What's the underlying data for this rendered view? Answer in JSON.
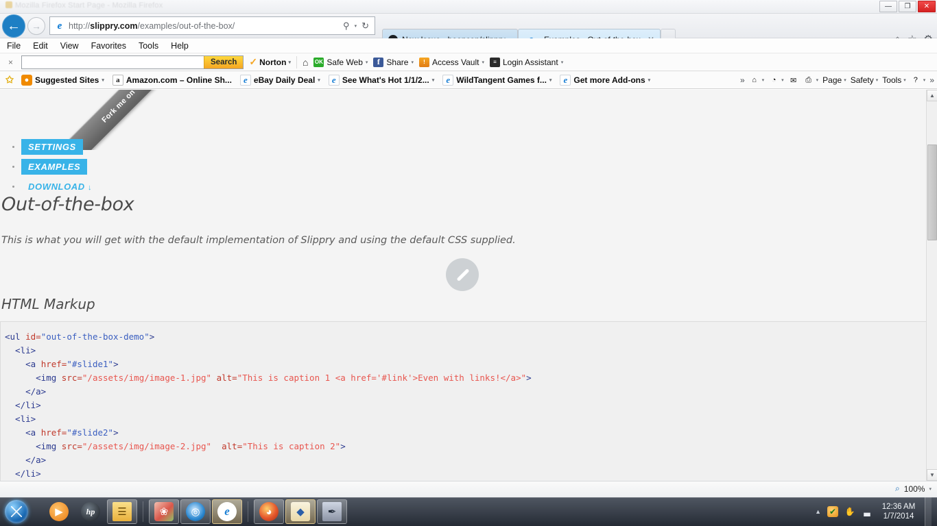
{
  "window": {
    "ghost_title": "Mozilla Firefox Start Page - Mozilla Firefox",
    "minimize": "—",
    "maximize": "❐",
    "close": "✕"
  },
  "browser": {
    "back_icon": "←",
    "forward_icon": "→",
    "url_prefix": "http://",
    "url_domain": "slippry.com",
    "url_path": "/examples/out-of-the-box/",
    "search_in_address_icon": "⚲",
    "address_caret": "▾",
    "refresh_icon": "↻",
    "tabs": [
      {
        "title": "New Issue · booncon/slippry",
        "icon": "github-icon",
        "active": false
      },
      {
        "title": "Examples - Out-of-the-box",
        "icon": "ie-icon",
        "active": true,
        "close": "✕"
      }
    ],
    "new_tab_label": "",
    "right_icons": [
      {
        "name": "home-icon",
        "glyph": "⌂"
      },
      {
        "name": "favorites-star-icon",
        "glyph": "☆"
      },
      {
        "name": "tools-gear-icon",
        "glyph": "⚙"
      }
    ]
  },
  "menubar": {
    "items": [
      "File",
      "Edit",
      "View",
      "Favorites",
      "Tools",
      "Help"
    ]
  },
  "toolbar_search": {
    "close_label": "×",
    "input_value": "",
    "input_placeholder": "",
    "search_button": "Search",
    "norton_label": "Norton",
    "norton_caret": "▾",
    "home_glyph": "⌂",
    "items": [
      {
        "label": "Safe Web",
        "badge": "OK",
        "badge_class": "badge-ok",
        "caret": "▾"
      },
      {
        "label": "Share",
        "badge": "f",
        "badge_class": "badge-fb",
        "caret": "▾"
      },
      {
        "label": "Access Vault",
        "badge": "!",
        "badge_class": "badge-vault",
        "caret": "▾"
      },
      {
        "label": "Login Assistant",
        "badge": "≡",
        "badge_class": "badge-login",
        "caret": "▾"
      }
    ]
  },
  "favorites_bar": {
    "add_star": "✩",
    "items": [
      {
        "label": "Suggested Sites",
        "icon": "suggested-sites-icon",
        "icon_class": "ico-sugg",
        "glyph": "●",
        "caret": "▾"
      },
      {
        "label": "Amazon.com – Online Sh...",
        "icon": "amazon-icon",
        "icon_class": "ico-amz",
        "glyph": "a",
        "caret": ""
      },
      {
        "label": "eBay Daily Deal",
        "icon": "ie-page-icon",
        "icon_class": "ico-ie",
        "glyph": "e",
        "caret": "▾"
      },
      {
        "label": "See What's Hot 1/1/2...",
        "icon": "ie-page-icon",
        "icon_class": "ico-ie",
        "glyph": "e",
        "caret": "▾"
      },
      {
        "label": "WildTangent Games f...",
        "icon": "ie-page-icon",
        "icon_class": "ico-ie",
        "glyph": "e",
        "caret": "▾"
      },
      {
        "label": "Get more Add-ons",
        "icon": "ie-page-icon",
        "icon_class": "ico-ie",
        "glyph": "e",
        "caret": "▾"
      }
    ],
    "overflow_chevron": "»",
    "command_items": [
      {
        "label": "",
        "name": "home-icon",
        "glyph": "⌂",
        "caret": "▾"
      },
      {
        "label": "",
        "name": "feeds-icon",
        "glyph": "◔",
        "caret": "▾"
      },
      {
        "label": "",
        "name": "read-mail-icon",
        "glyph": "✉",
        "caret": ""
      },
      {
        "label": "",
        "name": "print-icon",
        "glyph": "⎙",
        "caret": "▾"
      },
      {
        "label": "Page",
        "name": "page-menu",
        "glyph": "",
        "caret": "▾"
      },
      {
        "label": "Safety",
        "name": "safety-menu",
        "glyph": "",
        "caret": "▾"
      },
      {
        "label": "Tools",
        "name": "tools-menu",
        "glyph": "",
        "caret": "▾"
      },
      {
        "label": "",
        "name": "help-icon",
        "glyph": "?",
        "caret": "▾"
      }
    ],
    "right_chevron": "»"
  },
  "page": {
    "ribbon_text": "Fork me on GitHub",
    "nav": [
      {
        "label": "SETTINGS",
        "style": "pill"
      },
      {
        "label": "EXAMPLES",
        "style": "pill"
      },
      {
        "label": "DOWNLOAD",
        "style": "plain",
        "arrow": "↓"
      }
    ],
    "heading": "Out-of-the-box",
    "lede": "This is what you will get with the default implementation of Slippry and using the default CSS supplied.",
    "subheading": "HTML Markup",
    "slider_placeholder_icon": "broken-image-icon",
    "code_lines": [
      [
        {
          "t": "tg",
          "s": "<ul "
        },
        {
          "t": "at",
          "s": "id="
        },
        {
          "t": "vlb",
          "s": "\"out-of-the-box-demo\""
        },
        {
          "t": "tg",
          "s": ">"
        }
      ],
      [
        {
          "t": "tg",
          "s": "  <li>"
        }
      ],
      [
        {
          "t": "tg",
          "s": "    <a "
        },
        {
          "t": "at",
          "s": "href="
        },
        {
          "t": "vlb",
          "s": "\"#slide1\""
        },
        {
          "t": "tg",
          "s": ">"
        }
      ],
      [
        {
          "t": "tg",
          "s": "      <img "
        },
        {
          "t": "at",
          "s": "src="
        },
        {
          "t": "vl",
          "s": "\"/assets/img/image-1.jpg\""
        },
        {
          "t": "at",
          "s": " alt="
        },
        {
          "t": "vl",
          "s": "\"This is caption 1 <a href='#link'>Even with links!</a>\""
        },
        {
          "t": "tg",
          "s": ">"
        }
      ],
      [
        {
          "t": "tg",
          "s": "    </a>"
        }
      ],
      [
        {
          "t": "tg",
          "s": "  </li>"
        }
      ],
      [
        {
          "t": "tg",
          "s": "  <li>"
        }
      ],
      [
        {
          "t": "tg",
          "s": "    <a "
        },
        {
          "t": "at",
          "s": "href="
        },
        {
          "t": "vlb",
          "s": "\"#slide2\""
        },
        {
          "t": "tg",
          "s": ">"
        }
      ],
      [
        {
          "t": "tg",
          "s": "      <img "
        },
        {
          "t": "at",
          "s": "src="
        },
        {
          "t": "vl",
          "s": "\"/assets/img/image-2.jpg\""
        },
        {
          "t": "at",
          "s": "  alt="
        },
        {
          "t": "vl",
          "s": "\"This is caption 2\""
        },
        {
          "t": "tg",
          "s": ">"
        }
      ],
      [
        {
          "t": "tg",
          "s": "    </a>"
        }
      ],
      [
        {
          "t": "tg",
          "s": "  </li>"
        }
      ]
    ]
  },
  "statusbar": {
    "zoom_level": "100%",
    "zoom_caret": "▾",
    "zoom_icon": "⌕"
  },
  "taskbar": {
    "start_name": "start-orb",
    "buttons": [
      {
        "name": "windows-media-player",
        "glyph": "▶",
        "cls": "g-wmp",
        "state": "pinned"
      },
      {
        "name": "hp-support-assistant",
        "glyph": "hp",
        "cls": "g-hp",
        "state": "pinned"
      },
      {
        "name": "windows-explorer",
        "glyph": "☰",
        "cls": "g-exp",
        "state": "open"
      },
      {
        "name": "photo-viewer",
        "glyph": "❀",
        "cls": "g-pic",
        "state": "open"
      },
      {
        "name": "media-center",
        "glyph": "◎",
        "cls": "g-blue",
        "state": "open"
      },
      {
        "name": "internet-explorer",
        "glyph": "e",
        "cls": "g-ie",
        "state": "active"
      },
      {
        "name": "mozilla-firefox",
        "glyph": "◕",
        "cls": "g-ff",
        "state": "open"
      },
      {
        "name": "security-shield",
        "glyph": "◆",
        "cls": "g-shield",
        "state": "active"
      },
      {
        "name": "snipping-tool",
        "glyph": "✒",
        "cls": "g-pen",
        "state": "open"
      }
    ],
    "tray": {
      "show_hidden_caret": "▲",
      "icons": [
        {
          "name": "norton-tray-icon",
          "glyph": "✔",
          "cls": "tray-norton"
        },
        {
          "name": "clipboard-tray-icon",
          "glyph": "✋",
          "cls": ""
        },
        {
          "name": "network-signal-icon",
          "glyph": "▃",
          "cls": ""
        }
      ],
      "time": "12:36 AM",
      "date": "1/7/2014"
    }
  }
}
